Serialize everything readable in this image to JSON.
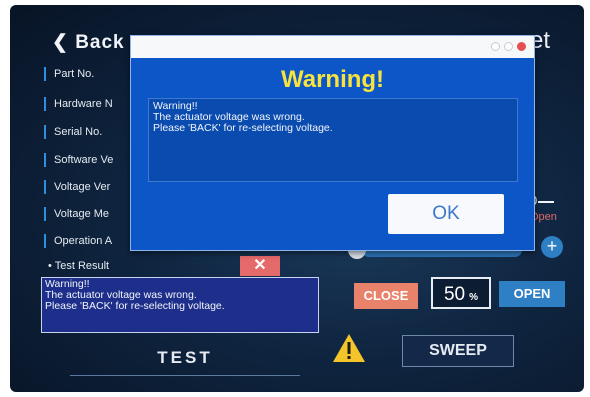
{
  "header": {
    "back_label": "❮ Back",
    "corner_text": "et"
  },
  "menu": {
    "items": [
      {
        "label": "Part No."
      },
      {
        "label": "Hardware N"
      },
      {
        "label": "Serial No."
      },
      {
        "label": "Software Ve"
      },
      {
        "label": "Voltage Ver"
      },
      {
        "label": "Voltage Me"
      },
      {
        "label": "Operation A"
      }
    ]
  },
  "test_result": {
    "label": "• Test Result",
    "message_line1": "Warning!!",
    "message_line2": "The actuator voltage was wrong.",
    "message_line3": "Please 'BACK' for re-selecting voltage.",
    "clear_symbol": "✕"
  },
  "controls": {
    "close_label": "CLOSE",
    "percent_value": "50",
    "percent_unit": "%",
    "open_label": "OPEN",
    "plus_symbol": "+",
    "gauge_zero": "0",
    "gauge_open": "Open"
  },
  "bottom": {
    "test_label": "TEST",
    "sweep_label": "SWEEP"
  },
  "dialog": {
    "title": "Warning!",
    "message_line1": "Warning!!",
    "message_line2": "The actuator voltage was wrong.",
    "message_line3": "Please 'BACK' for re-selecting voltage.",
    "ok_label": "OK"
  },
  "colors": {
    "dialog_bg": "#0c56c7",
    "dialog_title": "#f7e33c",
    "close_button": "#e8826a",
    "open_button": "#2f7fc4",
    "warning_icon": "#f4c52b"
  }
}
